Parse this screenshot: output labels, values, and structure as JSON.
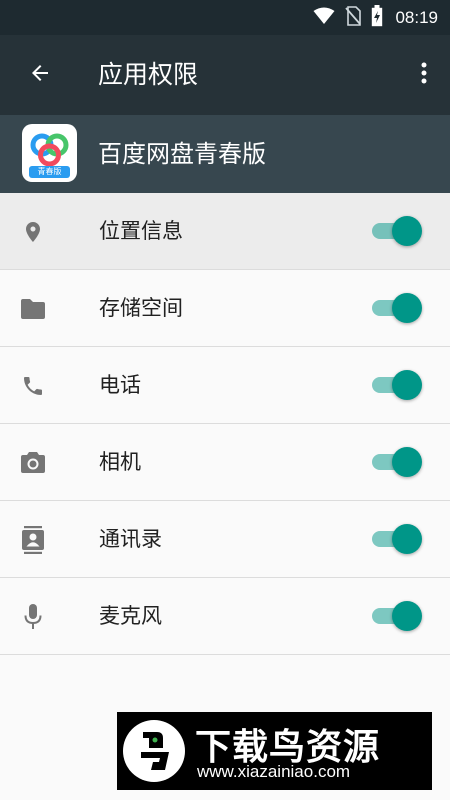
{
  "status_bar": {
    "time": "08:19",
    "icons": [
      "wifi-icon",
      "no-sim-icon",
      "battery-charging-icon"
    ]
  },
  "app_bar": {
    "title": "应用权限",
    "back_icon": "arrow-back-icon",
    "menu_icon": "more-vert-icon"
  },
  "app": {
    "name": "百度网盘青春版",
    "icon_tag": "青春版"
  },
  "permissions": [
    {
      "label": "位置信息",
      "icon": "location-icon",
      "enabled": true
    },
    {
      "label": "存储空间",
      "icon": "folder-icon",
      "enabled": true
    },
    {
      "label": "电话",
      "icon": "phone-icon",
      "enabled": true
    },
    {
      "label": "相机",
      "icon": "camera-icon",
      "enabled": true
    },
    {
      "label": "通讯录",
      "icon": "contacts-icon",
      "enabled": true
    },
    {
      "label": "麦克风",
      "icon": "microphone-icon",
      "enabled": true
    }
  ],
  "colors": {
    "status_bar": "#1e2a30",
    "app_bar": "#263238",
    "app_header": "#37474f",
    "accent": "#009688",
    "icon_gray": "#757575"
  },
  "watermark": {
    "title": "下载鸟资源",
    "url": "www.xiazainiao.com"
  }
}
